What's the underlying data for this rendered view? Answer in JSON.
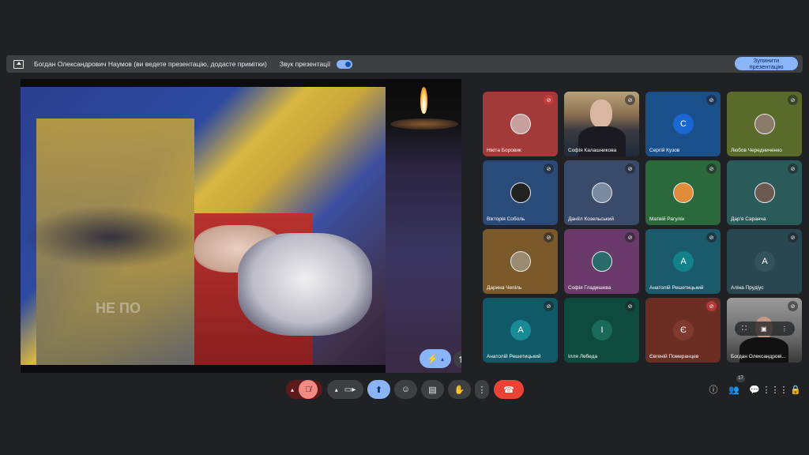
{
  "banner": {
    "message": "Богдан Олександрович Наумов (ви ведете презентацію, додасте примітки)",
    "sound_label": "Звук презентації",
    "stop_label": "Зупинити\nпрезентацію"
  },
  "presentation": {
    "slide_text": "НЕ ПО"
  },
  "participants": [
    {
      "name": "Нікіта Боровик",
      "bg": "#a33a3a",
      "type": "photo",
      "avatar_bg": "#c9a0a0",
      "mic": "muted-red"
    },
    {
      "name": "Софія Калашникова",
      "bg": "#6e5a4a",
      "type": "video",
      "mic": "muted"
    },
    {
      "name": "Сергій Кузов",
      "bg": "#1a4f8a",
      "type": "letter",
      "letter": "С",
      "avatar_bg": "#1967d2",
      "mic": "muted"
    },
    {
      "name": "Любов Чередниченко",
      "bg": "#5a6a2a",
      "type": "photo",
      "avatar_bg": "#8a7a6a",
      "mic": "muted"
    },
    {
      "name": "Вікторія Соболь",
      "bg": "#2a4a7a",
      "type": "photo",
      "avatar_bg": "#222",
      "mic": "muted"
    },
    {
      "name": "Даніїл Козельський",
      "bg": "#3a4a6a",
      "type": "photo",
      "avatar_bg": "#7a8aa0",
      "mic": "muted"
    },
    {
      "name": "Матвій Рагулін",
      "bg": "#2a6a3a",
      "type": "photo",
      "avatar_bg": "#e08a3a",
      "mic": "muted"
    },
    {
      "name": "Дар'я Саранча",
      "bg": "#2a5a5a",
      "type": "photo",
      "avatar_bg": "#6a5a50",
      "mic": "muted"
    },
    {
      "name": "Дарина Чепіль",
      "bg": "#7a5a2a",
      "type": "photo",
      "avatar_bg": "#9a8a70",
      "mic": "muted"
    },
    {
      "name": "Софія Гладишева",
      "bg": "#6a3a6a",
      "type": "photo",
      "avatar_bg": "#2a6a6a",
      "mic": "muted"
    },
    {
      "name": "Анатолій Решетицький",
      "bg": "#1a5a6a",
      "type": "letter",
      "letter": "А",
      "avatar_bg": "#12828a",
      "mic": "muted"
    },
    {
      "name": "Аліна Прудіус",
      "bg": "#2a4650",
      "type": "letter",
      "letter": "А",
      "avatar_bg": "#34525c",
      "mic": "muted"
    },
    {
      "name": "Анатолій Решетицький",
      "bg": "#0f5a66",
      "type": "letter",
      "letter": "А",
      "avatar_bg": "#1a8a96",
      "mic": "muted"
    },
    {
      "name": "Ілля Лебеда",
      "bg": "#0f4a3e",
      "type": "letter",
      "letter": "І",
      "avatar_bg": "#1a6a5a",
      "mic": "muted"
    },
    {
      "name": "Євгеній Померанцев",
      "bg": "#6a2e22",
      "type": "letter",
      "letter": "Є",
      "avatar_bg": "#7e3a2c",
      "mic": "muted-red"
    },
    {
      "name": "Богдан Олександрові...",
      "bg": "#5a5a5a",
      "type": "self",
      "mic": "muted"
    }
  ],
  "controls": {
    "participants_count": "17"
  },
  "colors": {
    "background": "#202124",
    "accent": "#8ab4f8",
    "mic_off": "#f28b82",
    "hangup": "#ea4335"
  }
}
